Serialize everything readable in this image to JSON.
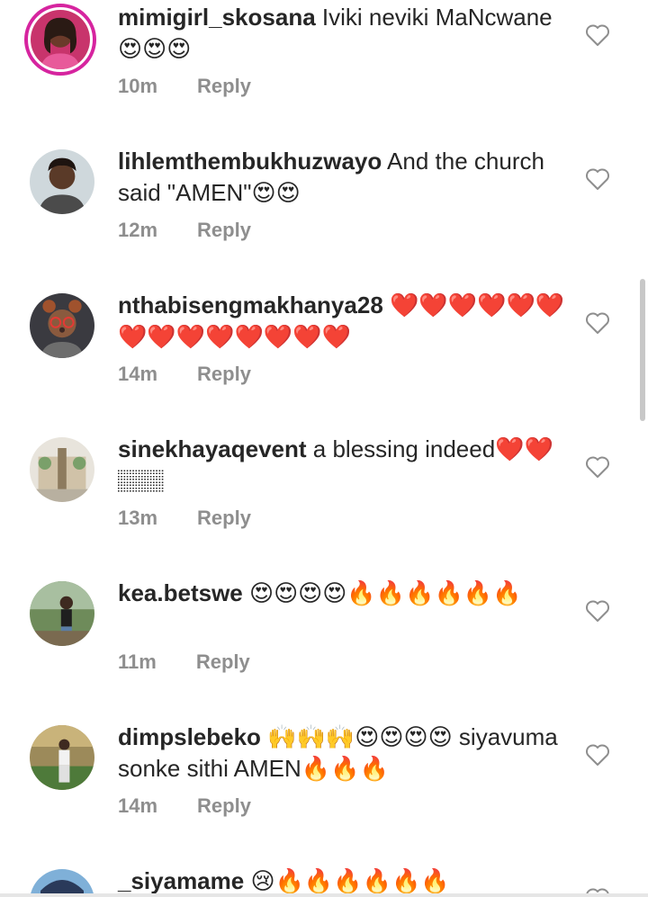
{
  "comments": [
    {
      "username": "mimigirl_skosana",
      "text": " Iviki neviki MaNcwane 😍😍😍",
      "time": "10m",
      "reply": "Reply",
      "avatar": "avatar-mimigirl"
    },
    {
      "username": "lihlemthembukhuzwayo",
      "text": " And the church said \"AMEN\"😍😍",
      "time": "12m",
      "reply": "Reply",
      "avatar": "avatar-lihle"
    },
    {
      "username": "nthabisengmakhanya28",
      "text": " ❤️❤️❤️❤️❤️❤️❤️❤️❤️❤️❤️❤️❤️❤️",
      "time": "14m",
      "reply": "Reply",
      "avatar": "avatar-nthabiseng"
    },
    {
      "username": "sinekhayaqevent",
      "text": " a blessing indeed❤️❤️🏽🏽",
      "time": "13m",
      "reply": "Reply",
      "avatar": "avatar-sinekhaya"
    },
    {
      "username": "kea.betswe",
      "text": " 😍😍😍😍🔥🔥🔥🔥🔥🔥",
      "time": "11m",
      "reply": "Reply",
      "avatar": "avatar-kea"
    },
    {
      "username": "dimpslebeko",
      "text": " 🙌🙌🙌😍😍😍😍 siyavuma sonke sithi AMEN🔥🔥🔥",
      "time": "14m",
      "reply": "Reply",
      "avatar": "avatar-dimps"
    },
    {
      "username": "_siyamame",
      "text": " 😢🔥🔥🔥🔥🔥🔥",
      "time": "",
      "reply": "",
      "avatar": "avatar-siyamame"
    }
  ],
  "icons": {
    "like": "heart-outline-icon"
  },
  "colors": {
    "meta": "#8e8e8e",
    "text": "#262626",
    "story_ring": "#d6249f"
  }
}
